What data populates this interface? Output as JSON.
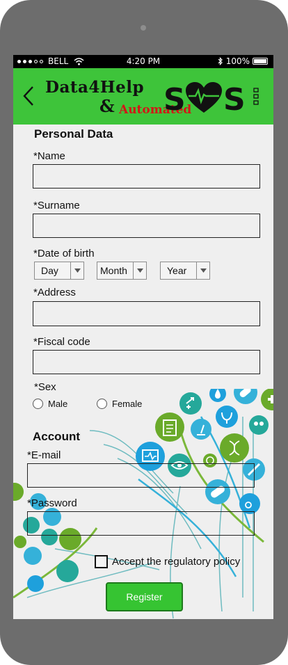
{
  "status_bar": {
    "carrier": "BELL",
    "time": "4:20 PM",
    "battery": "100%"
  },
  "header": {
    "logo_line1": "Data4Help",
    "logo_amp": "&",
    "logo_automated": "Automated",
    "logo_sos": "SOS"
  },
  "personal": {
    "title": "Personal Data",
    "name_label": "*Name",
    "name_value": "",
    "surname_label": "*Surname",
    "surname_value": "",
    "dob_label": "*Date of birth",
    "day": "Day",
    "month": "Month",
    "year": "Year",
    "address_label": "*Address",
    "address_value": "",
    "fiscal_label": "*Fiscal code",
    "fiscal_value": "",
    "sex_label": "*Sex",
    "male": "Male",
    "female": "Female"
  },
  "account": {
    "title": "Account",
    "email_label": "*E-mail",
    "email_value": "",
    "password_label": "*Password",
    "password_value": "",
    "accept_label": "Accept the regulatory policy",
    "register_label": "Register"
  },
  "colors": {
    "header_green": "#3ec43a",
    "button_green": "#36c432",
    "accent_red": "#d21717",
    "icon_blue": "#1ea0dc",
    "icon_green": "#6aaa2a",
    "icon_teal": "#25a89a"
  }
}
